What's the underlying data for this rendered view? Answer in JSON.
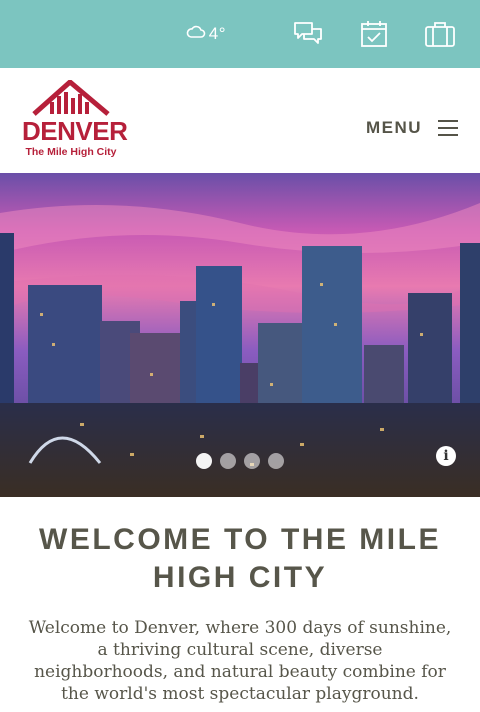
{
  "topbar": {
    "weather_temp": "4°",
    "icons": [
      "cloud-icon",
      "chat-icon",
      "calendar-check-icon",
      "suitcase-icon"
    ]
  },
  "header": {
    "logo_word": "DENVER",
    "logo_tagline": "The Mile High City",
    "menu_label": "MENU"
  },
  "hero": {
    "slide_count": 4,
    "active_slide": 1,
    "info_label": "i"
  },
  "welcome": {
    "title": "WELCOME TO THE MILE HIGH CITY",
    "text": "Welcome to Denver, where 300 days of sunshine, a thriving cultural scene, diverse neighborhoods, and natural beauty combine for the world's most spectacular playground."
  },
  "colors": {
    "topbar": "#7cc5c0",
    "brand_red": "#b6203a",
    "heading_gray": "#57564a"
  }
}
